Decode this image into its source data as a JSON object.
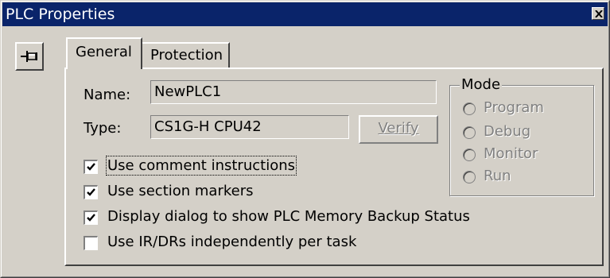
{
  "window": {
    "title": "PLC Properties"
  },
  "tabs": [
    {
      "label": "General",
      "active": true
    },
    {
      "label": "Protection",
      "active": false
    }
  ],
  "general": {
    "name_label": "Name:",
    "name_value": "NewPLC1",
    "type_label": "Type:",
    "type_value": "CS1G-H  CPU42",
    "verify_label": "Verify",
    "verify_enabled": false
  },
  "options": [
    {
      "label": "Use comment instructions",
      "checked": true
    },
    {
      "label": "Use section markers",
      "checked": true
    },
    {
      "label": "Display dialog to show PLC Memory Backup Status",
      "checked": true
    },
    {
      "label": "Use IR/DRs independently per task",
      "checked": false
    }
  ],
  "mode": {
    "title": "Mode",
    "options": [
      "Program",
      "Debug",
      "Monitor",
      "Run"
    ],
    "enabled": false
  },
  "icons": {
    "pin": "pushpin-icon",
    "close": "close-icon"
  }
}
